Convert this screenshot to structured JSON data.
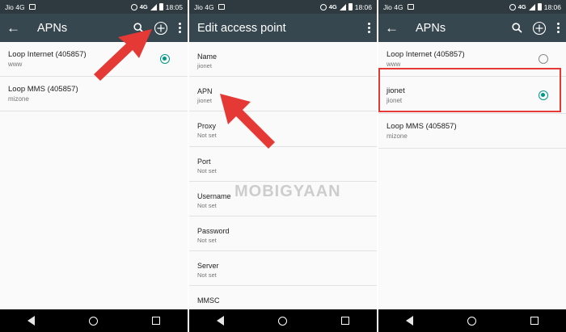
{
  "screen1": {
    "status": {
      "carrier": "Jio 4G",
      "network": "4G",
      "time": "18:05"
    },
    "title": "APNs",
    "apns": [
      {
        "name": "Loop Internet (405857)",
        "apn": "www",
        "selected": true
      },
      {
        "name": "Loop MMS (405857)",
        "apn": "mizone",
        "selected": false
      }
    ]
  },
  "screen2": {
    "status": {
      "carrier": "Jio 4G",
      "network": "4G",
      "time": "18:06"
    },
    "title": "Edit access point",
    "fields": [
      {
        "label": "Name",
        "value": "jionet"
      },
      {
        "label": "APN",
        "value": "jionet"
      },
      {
        "label": "Proxy",
        "value": "Not set"
      },
      {
        "label": "Port",
        "value": "Not set"
      },
      {
        "label": "Username",
        "value": "Not set"
      },
      {
        "label": "Password",
        "value": "Not set"
      },
      {
        "label": "Server",
        "value": "Not set"
      },
      {
        "label": "MMSC",
        "value": ""
      }
    ]
  },
  "screen3": {
    "status": {
      "carrier": "Jio 4G",
      "network": "4G",
      "time": "18:06"
    },
    "title": "APNs",
    "apns": [
      {
        "name": "Loop Internet (405857)",
        "apn": "www",
        "selected": false
      },
      {
        "name": "jionet",
        "apn": "jionet",
        "selected": true
      },
      {
        "name": "Loop MMS (405857)",
        "apn": "mizone",
        "selected": false
      }
    ]
  },
  "watermark": "MOBIGYAAN",
  "colors": {
    "statusbar": "#2e3a3f",
    "appbar": "#37474f",
    "accent": "#009688",
    "arrow": "#e53935"
  }
}
